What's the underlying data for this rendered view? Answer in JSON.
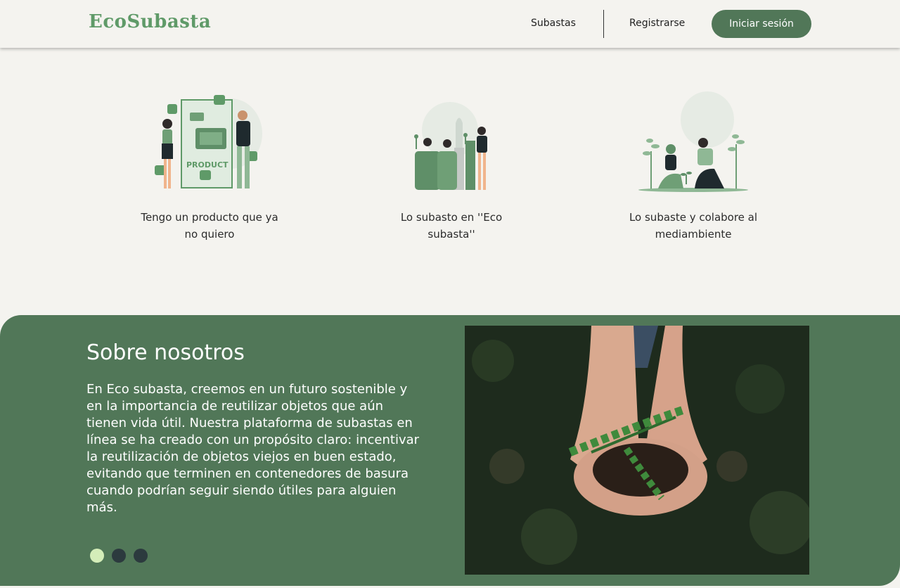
{
  "header": {
    "logo": "EcoSubasta",
    "nav": {
      "subastas": "Subastas",
      "registrarse": "Registrarse",
      "login": "Iniciar sesión"
    }
  },
  "steps": [
    {
      "text": "Tengo un producto que ya no quiero",
      "illustration_label": "PRODUCT"
    },
    {
      "text": "Lo subasto en  ''Eco subasta''"
    },
    {
      "text": "Lo subaste y colabore al mediambiente"
    }
  ],
  "about": {
    "title": "Sobre nosotros",
    "body": "En Eco subasta, creemos en un futuro sostenible y en la importancia de reutilizar objetos que aún tienen vida útil. Nuestra plataforma de subastas en línea se ha creado con un propósito claro: incentivar la reutilización de objetos viejos en buen estado, evitando que terminen en contenedores de basura cuando podrían seguir siendo útiles para alguien más.",
    "carousel": {
      "count": 3,
      "active_index": 0
    }
  },
  "colors": {
    "brand_green": "#517758",
    "logo_green": "#5f9a68",
    "background": "#f4f3ef",
    "dot_active": "#d4edb9",
    "dot_inactive": "#2c3a3e"
  }
}
